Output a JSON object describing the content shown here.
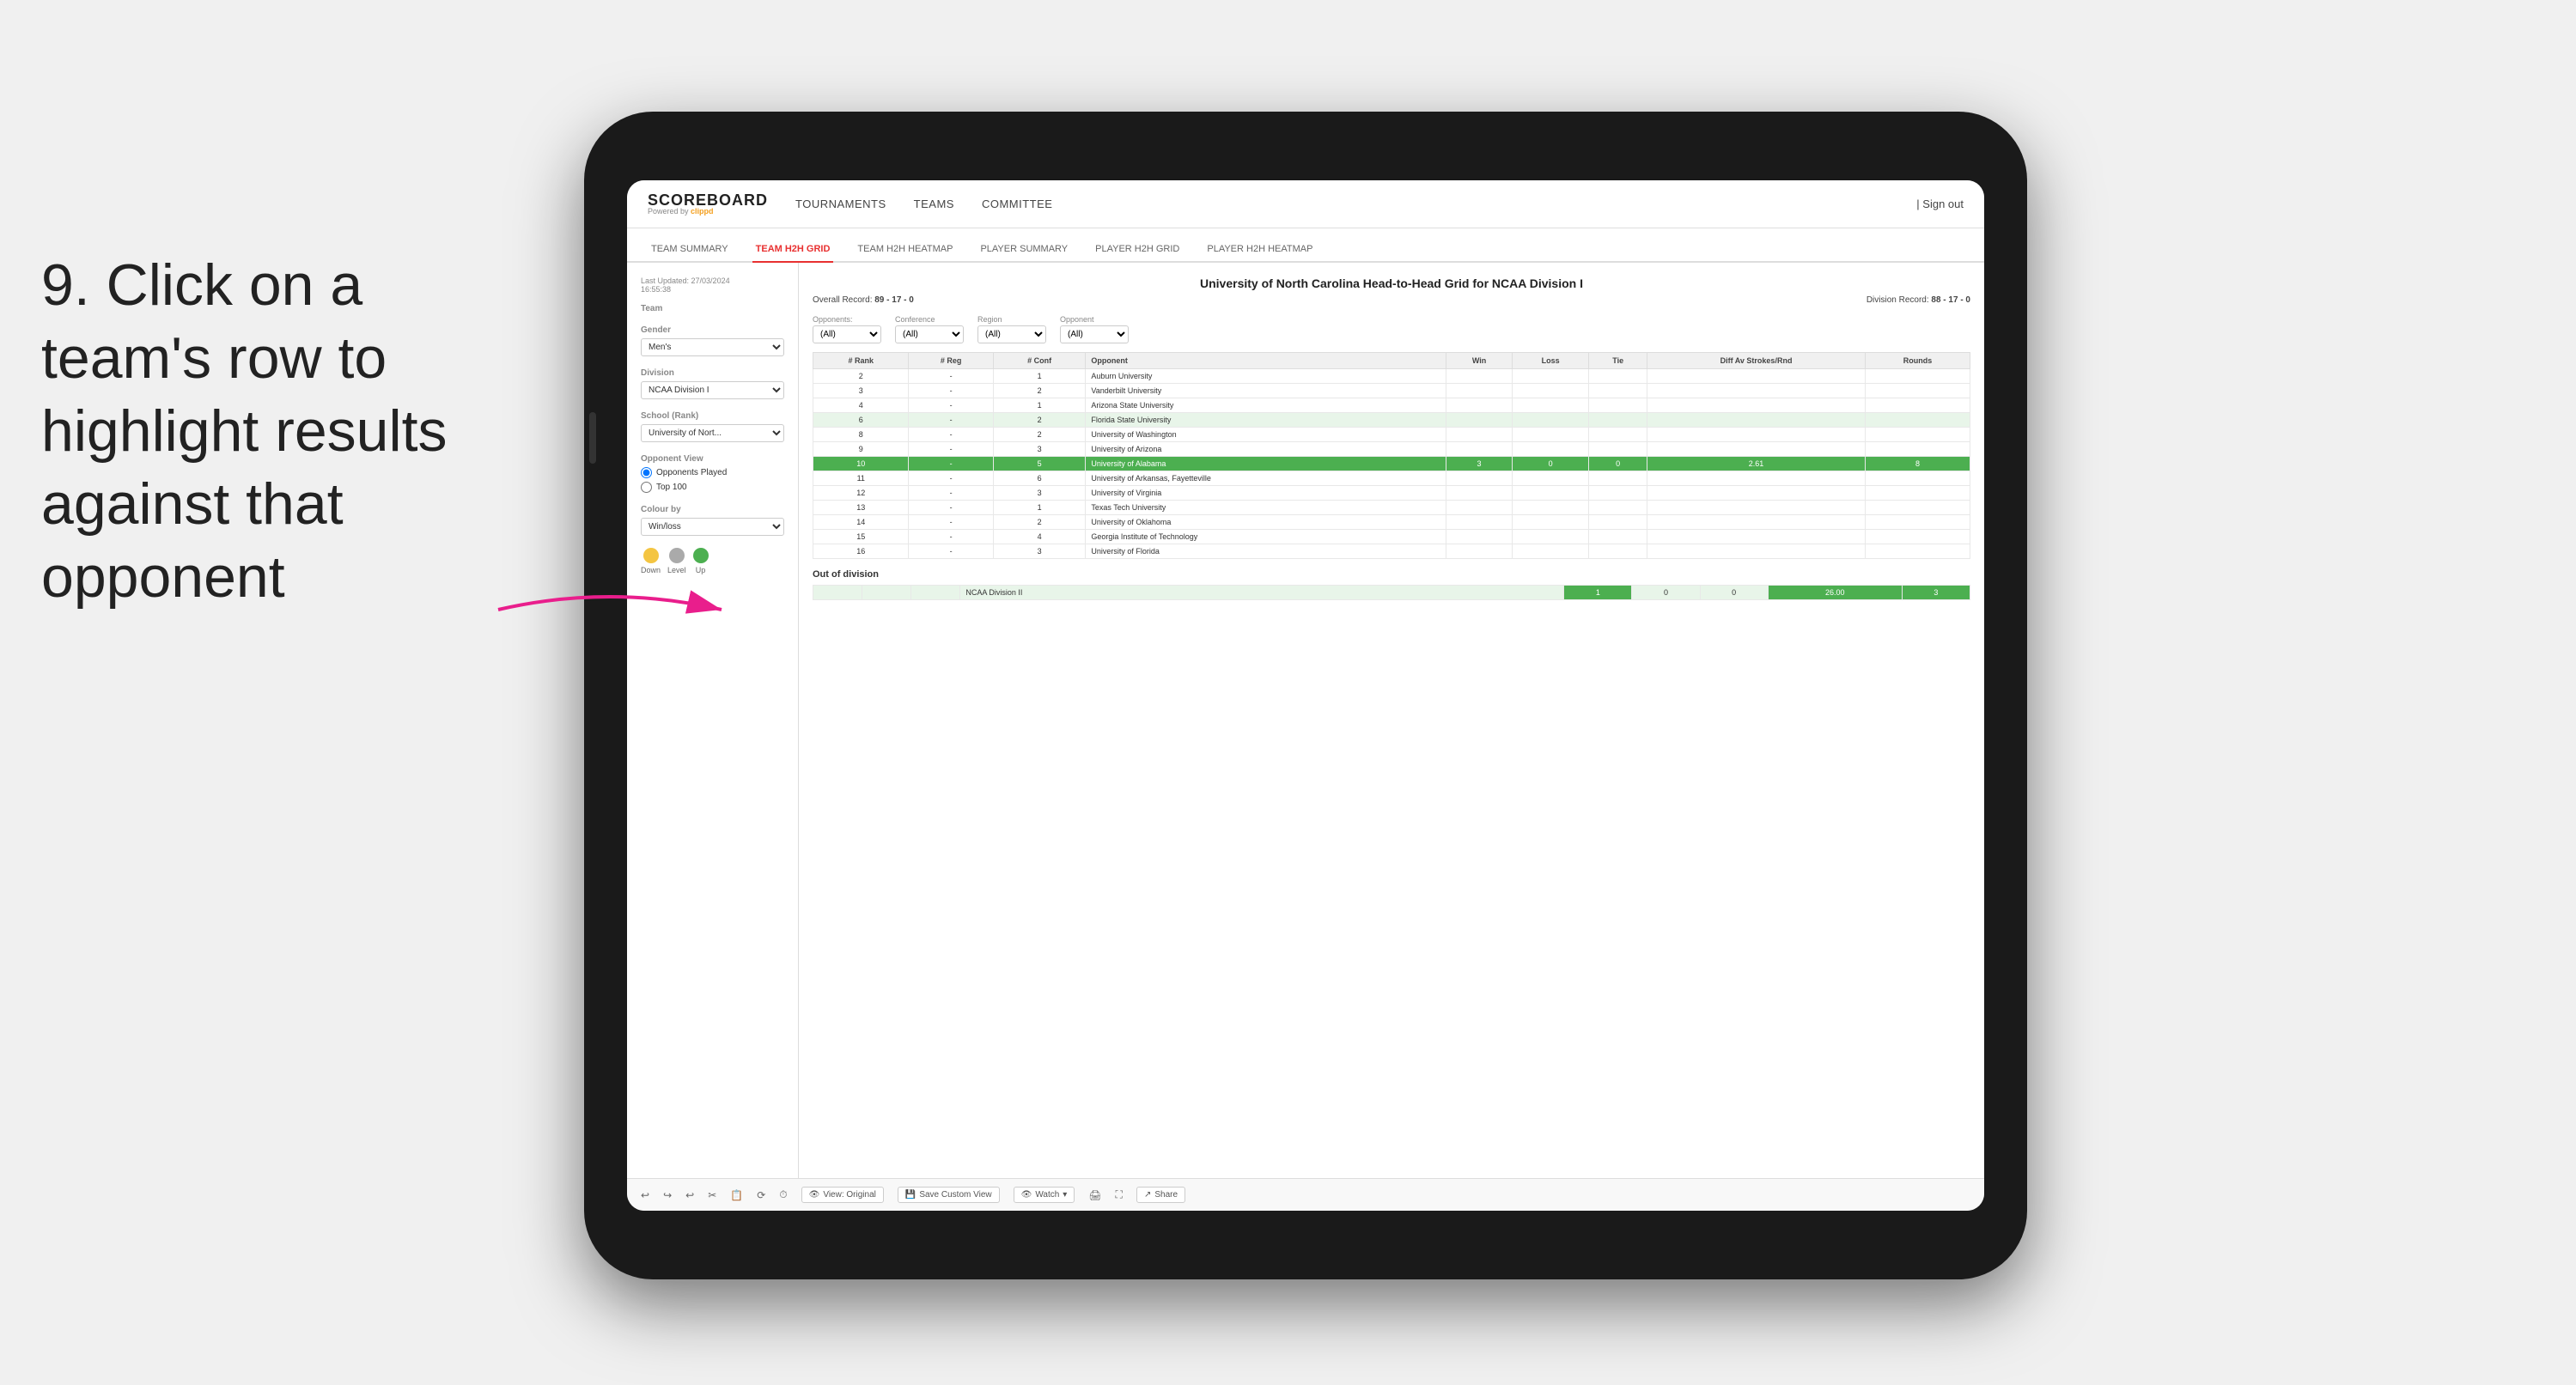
{
  "instruction": {
    "number": "9.",
    "text": "Click on a team's row to highlight results against that opponent"
  },
  "nav": {
    "logo": "SCOREBOARD",
    "powered_by": "Powered by",
    "brand": "clippd",
    "items": [
      "TOURNAMENTS",
      "TEAMS",
      "COMMITTEE"
    ],
    "sign_in": "Sign out"
  },
  "sub_nav": {
    "items": [
      "TEAM SUMMARY",
      "TEAM H2H GRID",
      "TEAM H2H HEATMAP",
      "PLAYER SUMMARY",
      "PLAYER H2H GRID",
      "PLAYER H2H HEATMAP"
    ],
    "active": "TEAM H2H GRID"
  },
  "sidebar": {
    "last_updated_label": "Last Updated: 27/03/2024",
    "last_updated_time": "16:55:38",
    "team_label": "Team",
    "gender_label": "Gender",
    "gender_value": "Men's",
    "division_label": "Division",
    "division_value": "NCAA Division I",
    "school_label": "School (Rank)",
    "school_value": "University of Nort...",
    "opponent_view_label": "Opponent View",
    "opponents_played": "Opponents Played",
    "top100": "Top 100",
    "colour_by_label": "Colour by",
    "colour_by_value": "Win/loss",
    "legend": {
      "down_label": "Down",
      "level_label": "Level",
      "up_label": "Up"
    }
  },
  "grid": {
    "title": "University of North Carolina Head-to-Head Grid for NCAA Division I",
    "overall_record_label": "Overall Record:",
    "overall_record": "89 - 17 - 0",
    "division_record_label": "Division Record:",
    "division_record": "88 - 17 - 0",
    "filters": {
      "opponents_label": "Opponents:",
      "opponents_value": "(All)",
      "conference_label": "Conference",
      "conference_value": "(All)",
      "region_label": "Region",
      "region_value": "(All)",
      "opponent_label": "Opponent",
      "opponent_value": "(All)"
    },
    "columns": [
      "# Rank",
      "# Reg",
      "# Conf",
      "Opponent",
      "Win",
      "Loss",
      "Tie",
      "Diff Av Strokes/Rnd",
      "Rounds"
    ],
    "rows": [
      {
        "rank": "2",
        "reg": "-",
        "conf": "1",
        "opponent": "Auburn University",
        "win": "",
        "loss": "",
        "tie": "",
        "diff": "",
        "rounds": "",
        "highlight": false,
        "light": false
      },
      {
        "rank": "3",
        "reg": "-",
        "conf": "2",
        "opponent": "Vanderbilt University",
        "win": "",
        "loss": "",
        "tie": "",
        "diff": "",
        "rounds": "",
        "highlight": false,
        "light": false
      },
      {
        "rank": "4",
        "reg": "-",
        "conf": "1",
        "opponent": "Arizona State University",
        "win": "",
        "loss": "",
        "tie": "",
        "diff": "",
        "rounds": "",
        "highlight": false,
        "light": false
      },
      {
        "rank": "6",
        "reg": "-",
        "conf": "2",
        "opponent": "Florida State University",
        "win": "",
        "loss": "",
        "tie": "",
        "diff": "",
        "rounds": "",
        "highlight": false,
        "light": true
      },
      {
        "rank": "8",
        "reg": "-",
        "conf": "2",
        "opponent": "University of Washington",
        "win": "",
        "loss": "",
        "tie": "",
        "diff": "",
        "rounds": "",
        "highlight": false,
        "light": false
      },
      {
        "rank": "9",
        "reg": "-",
        "conf": "3",
        "opponent": "University of Arizona",
        "win": "",
        "loss": "",
        "tie": "",
        "diff": "",
        "rounds": "",
        "highlight": false,
        "light": false
      },
      {
        "rank": "10",
        "reg": "-",
        "conf": "5",
        "opponent": "University of Alabama",
        "win": "3",
        "loss": "0",
        "tie": "0",
        "diff": "2.61",
        "rounds": "8",
        "highlight": true,
        "light": false
      },
      {
        "rank": "11",
        "reg": "-",
        "conf": "6",
        "opponent": "University of Arkansas, Fayetteville",
        "win": "",
        "loss": "",
        "tie": "",
        "diff": "",
        "rounds": "",
        "highlight": false,
        "light": false
      },
      {
        "rank": "12",
        "reg": "-",
        "conf": "3",
        "opponent": "University of Virginia",
        "win": "",
        "loss": "",
        "tie": "",
        "diff": "",
        "rounds": "",
        "highlight": false,
        "light": false
      },
      {
        "rank": "13",
        "reg": "-",
        "conf": "1",
        "opponent": "Texas Tech University",
        "win": "",
        "loss": "",
        "tie": "",
        "diff": "",
        "rounds": "",
        "highlight": false,
        "light": false
      },
      {
        "rank": "14",
        "reg": "-",
        "conf": "2",
        "opponent": "University of Oklahoma",
        "win": "",
        "loss": "",
        "tie": "",
        "diff": "",
        "rounds": "",
        "highlight": false,
        "light": false
      },
      {
        "rank": "15",
        "reg": "-",
        "conf": "4",
        "opponent": "Georgia Institute of Technology",
        "win": "",
        "loss": "",
        "tie": "",
        "diff": "",
        "rounds": "",
        "highlight": false,
        "light": false
      },
      {
        "rank": "16",
        "reg": "-",
        "conf": "3",
        "opponent": "University of Florida",
        "win": "",
        "loss": "",
        "tie": "",
        "diff": "",
        "rounds": "",
        "highlight": false,
        "light": false
      }
    ],
    "out_of_division_label": "Out of division",
    "out_of_division_row": {
      "name": "NCAA Division II",
      "win": "1",
      "loss": "0",
      "tie": "0",
      "diff": "26.00",
      "rounds": "3"
    }
  },
  "toolbar": {
    "view_label": "View: Original",
    "save_label": "Save Custom View",
    "watch_label": "Watch",
    "share_label": "Share"
  }
}
